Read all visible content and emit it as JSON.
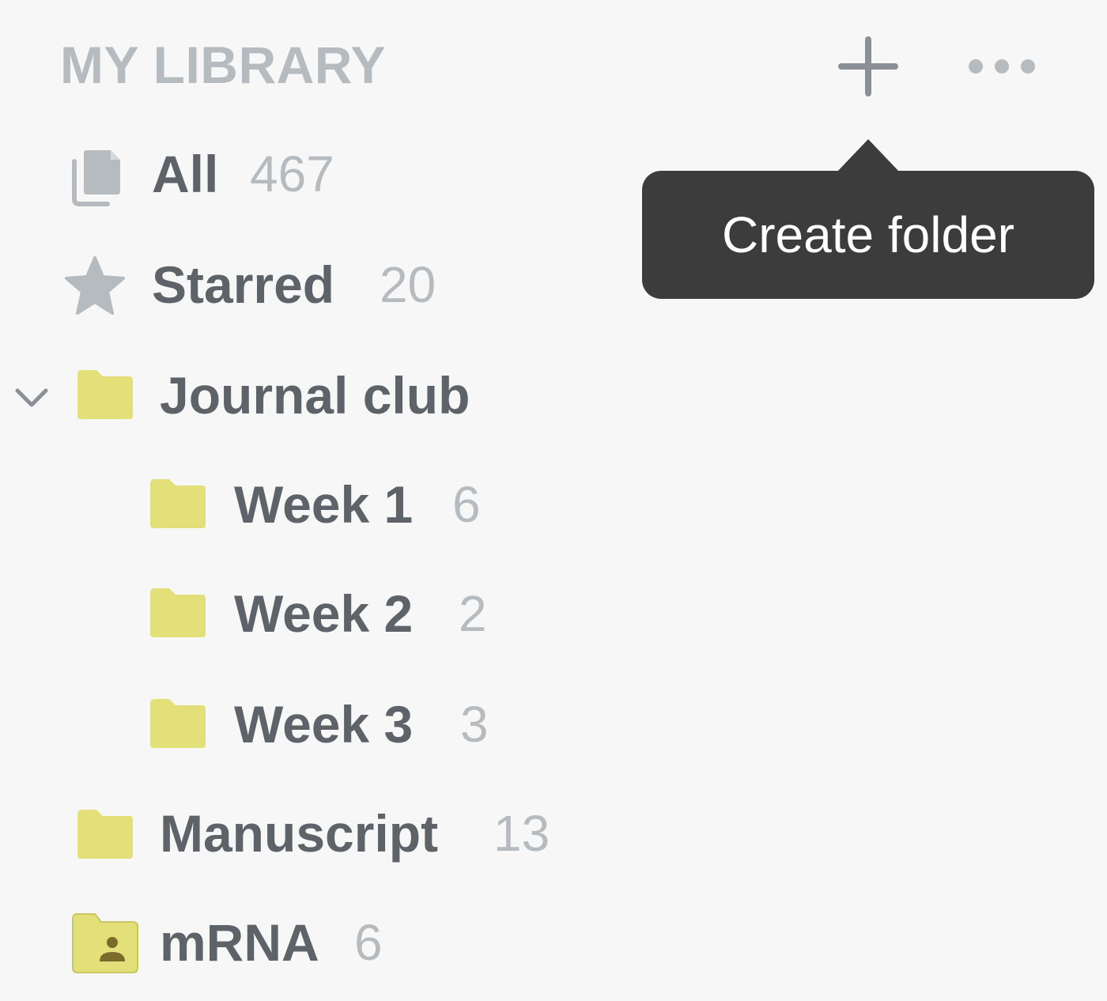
{
  "library": {
    "title": "MY LIBRARY",
    "add_icon": "plus-icon",
    "more_icon": "ellipsis-icon"
  },
  "tooltip": {
    "text": "Create folder"
  },
  "items": [
    {
      "label": "All",
      "count": "467",
      "icon": "documents-icon"
    },
    {
      "label": "Starred",
      "count": "20",
      "icon": "star-icon"
    },
    {
      "label": "Journal club",
      "count": "",
      "icon": "folder-icon",
      "expanded": true
    },
    {
      "label": "Week 1",
      "count": "6",
      "icon": "folder-icon"
    },
    {
      "label": "Week 2",
      "count": "2",
      "icon": "folder-icon"
    },
    {
      "label": "Week 3",
      "count": "3",
      "icon": "folder-icon"
    },
    {
      "label": "Manuscript",
      "count": "13",
      "icon": "folder-icon"
    },
    {
      "label": "mRNA",
      "count": "6",
      "icon": "shared-folder-icon"
    }
  ],
  "colors": {
    "folder": "#e3e07a",
    "icon_gray": "#b6bbbf",
    "text": "#5d6368",
    "tooltip_bg": "#3c3c3c"
  }
}
